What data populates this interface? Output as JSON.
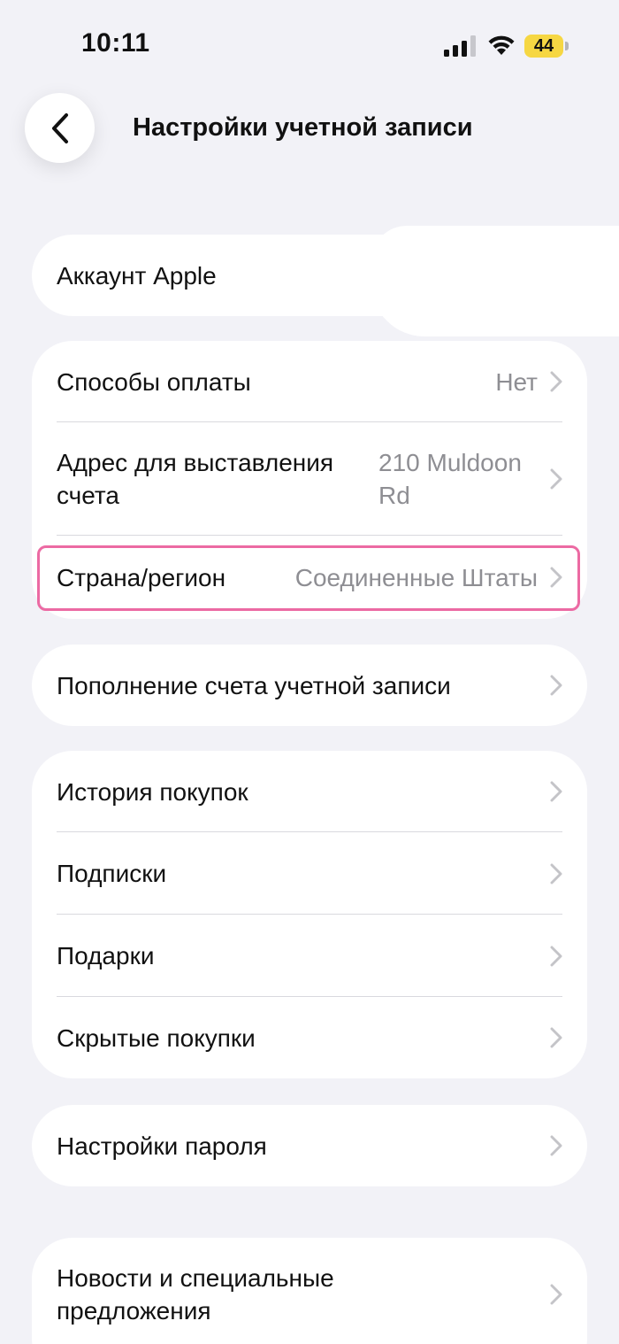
{
  "status_bar": {
    "time": "10:11",
    "battery": "44",
    "battery_color": "#f6d743"
  },
  "header": {
    "back_icon": "chevron-left-icon",
    "title": "Настройки учетной записи"
  },
  "sections": {
    "account": {
      "label": "Аккаунт Apple"
    },
    "payment": {
      "payment_methods": {
        "label": "Способы оплаты",
        "value": "Нет"
      },
      "billing_address": {
        "label": "Адрес для выставления счета",
        "value": "210 Muldoon Rd"
      },
      "country_region": {
        "label": "Страна/регион",
        "value": "Соединенные Штаты",
        "highlight_color": "#ec6aa3"
      }
    },
    "topup": {
      "label": "Пополнение счета учетной записи"
    },
    "purchases": {
      "history": {
        "label": "История покупок"
      },
      "subscriptions": {
        "label": "Подписки"
      },
      "gifts": {
        "label": "Подарки"
      },
      "hidden": {
        "label": "Скрытые покупки"
      }
    },
    "password": {
      "label": "Настройки пароля"
    },
    "news": {
      "label": "Новости и специальные предложения"
    }
  }
}
